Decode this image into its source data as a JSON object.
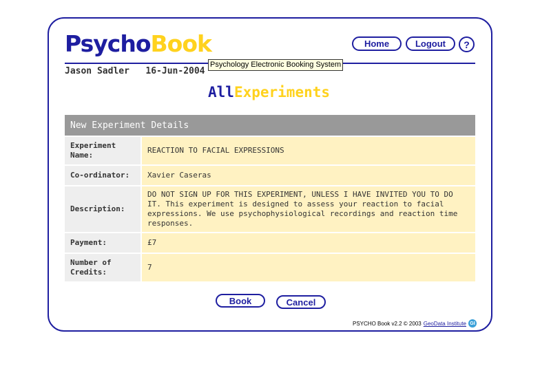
{
  "app": {
    "logo_part1": "Psycho",
    "logo_part2": "Book",
    "tooltip": "Psychology Electronic Booking System"
  },
  "nav": {
    "home": "Home",
    "logout": "Logout",
    "help": "?"
  },
  "user": {
    "name": "Jason Sadler",
    "date": "16-Jun-2004"
  },
  "page_title": {
    "part1": "All",
    "part2": "Experiments"
  },
  "details": {
    "header": "New Experiment Details",
    "rows": [
      {
        "label": "Experiment Name:",
        "value": "REACTION TO FACIAL EXPRESSIONS"
      },
      {
        "label": "Co-ordinator:",
        "value": "Xavier Caseras"
      },
      {
        "label": "Description:",
        "value": "DO NOT SIGN UP FOR THIS EXPERIMENT, UNLESS I HAVE INVITED YOU TO DO IT. This experiment is designed to assess your reaction to facial expressions. We use psychophysiological recordings and reaction time responses."
      },
      {
        "label": "Payment:",
        "value": "£7"
      },
      {
        "label": "Number of Credits:",
        "value": "7"
      }
    ]
  },
  "actions": {
    "book": "Book",
    "cancel": "Cancel"
  },
  "footer": {
    "text": "PSYCHO Book v2.2 © 2003",
    "link": "GeoData Institute",
    "icon_glyph": "GI"
  },
  "colors": {
    "brand_blue": "#1e1ea0",
    "brand_yellow": "#ffd21e",
    "table_value_bg": "#fff2c2",
    "table_header_bg": "#999999"
  }
}
